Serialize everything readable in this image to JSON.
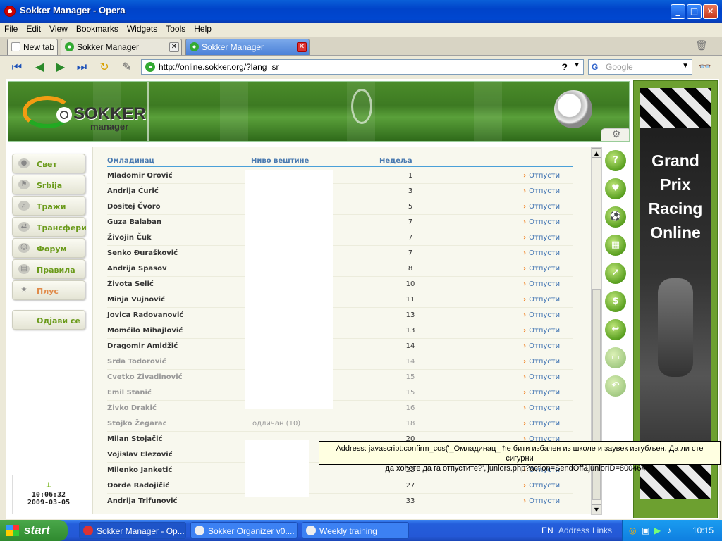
{
  "window": {
    "title": "Sokker Manager - Opera",
    "min": "_",
    "max": "□",
    "close": "✕"
  },
  "menu": [
    "File",
    "Edit",
    "View",
    "Bookmarks",
    "Widgets",
    "Tools",
    "Help"
  ],
  "tabs": [
    {
      "label": "New tab"
    },
    {
      "label": "Sokker Manager"
    },
    {
      "label": "Sokker Manager"
    }
  ],
  "address": {
    "url": "http://online.sokker.org/?lang=sr"
  },
  "search": {
    "placeholder": "Google"
  },
  "logo": {
    "line1": "SOKKER",
    "line2": "manager"
  },
  "nav": [
    {
      "label": "Свет",
      "icon": "globe-icon"
    },
    {
      "label": "Srbija",
      "icon": "flag-icon"
    },
    {
      "label": "Тражи",
      "icon": "magnifier-icon"
    },
    {
      "label": "Трансфери",
      "icon": "transfer-icon"
    },
    {
      "label": "Форум",
      "icon": "people-icon"
    },
    {
      "label": "Правила",
      "icon": "book-icon"
    },
    {
      "label": "Плус",
      "icon": "star-icon"
    },
    {
      "label": "Одјави се",
      "icon": ""
    }
  ],
  "clock": {
    "time": "10:06:32",
    "date": "2009-03-05"
  },
  "table": {
    "headers": {
      "name": "Омладинац",
      "skill": "Ниво вештине",
      "week": "Недеља"
    },
    "action_label": "Отпусти",
    "rows": [
      {
        "name": "Mladomir Orović",
        "skill": "",
        "week": "1"
      },
      {
        "name": "Andrija Ćurić",
        "skill": "",
        "week": "3"
      },
      {
        "name": "Dositej Čvoro",
        "skill": "",
        "week": "5"
      },
      {
        "name": "Guza Balaban",
        "skill": "",
        "week": "7"
      },
      {
        "name": "Živojin Čuk",
        "skill": "",
        "week": "7"
      },
      {
        "name": "Senko Đurašković",
        "skill": "",
        "week": "7"
      },
      {
        "name": "Andrija Spasov",
        "skill": "",
        "week": "8"
      },
      {
        "name": "Života Selić",
        "skill": "",
        "week": "10"
      },
      {
        "name": "Minja Vujnović",
        "skill": "",
        "week": "11"
      },
      {
        "name": "Jovica Radovanović",
        "skill": "",
        "week": "13"
      },
      {
        "name": "Momčilo Mihajlović",
        "skill": "",
        "week": "13"
      },
      {
        "name": "Dragomir Amidžić",
        "skill": "",
        "week": "14"
      },
      {
        "name": "Srđa Todorović",
        "skill": "",
        "week": "14"
      },
      {
        "name": "Cvetko Živadinović",
        "skill": "",
        "week": "15"
      },
      {
        "name": "Emil Stanić",
        "skill": "",
        "week": "15"
      },
      {
        "name": "Živko Drakić",
        "skill": "",
        "week": "16"
      },
      {
        "name": "Stojko Žegarac",
        "skill": "одличан (10)",
        "week": "18"
      },
      {
        "name": "Milan Stojačić",
        "skill": "",
        "week": "20"
      },
      {
        "name": "Vojislav Elezović",
        "skill": "",
        "week": "21"
      },
      {
        "name": "Milenko Janketić",
        "skill": "",
        "week": "23"
      },
      {
        "name": "Đorđe Radojičić",
        "skill": "",
        "week": "27"
      },
      {
        "name": "Andrija Trifunović",
        "skill": "",
        "week": "33"
      }
    ]
  },
  "right_icons": [
    "?",
    "♥",
    "⚽",
    "▦",
    "↗",
    "$",
    "↩",
    "▭",
    "↶"
  ],
  "ad": {
    "text": "Grand Prix Racing Online"
  },
  "tooltip": {
    "line1": "Address: javascript:confirm_cos('_Омладинац_ ће бити избачен из школе и заувек изгубљен. Да ли сте сигурни",
    "line2": "да хоћете да га отпустите?','juniors.php?action=SendOff&juniorID=8004648')"
  },
  "taskbar": {
    "start": "start",
    "tasks": [
      "Sokker Manager - Op...",
      "Sokker Organizer v0....",
      "Weekly training"
    ],
    "lang": "EN",
    "address": "Address",
    "links": "Links",
    "time": "10:15"
  }
}
